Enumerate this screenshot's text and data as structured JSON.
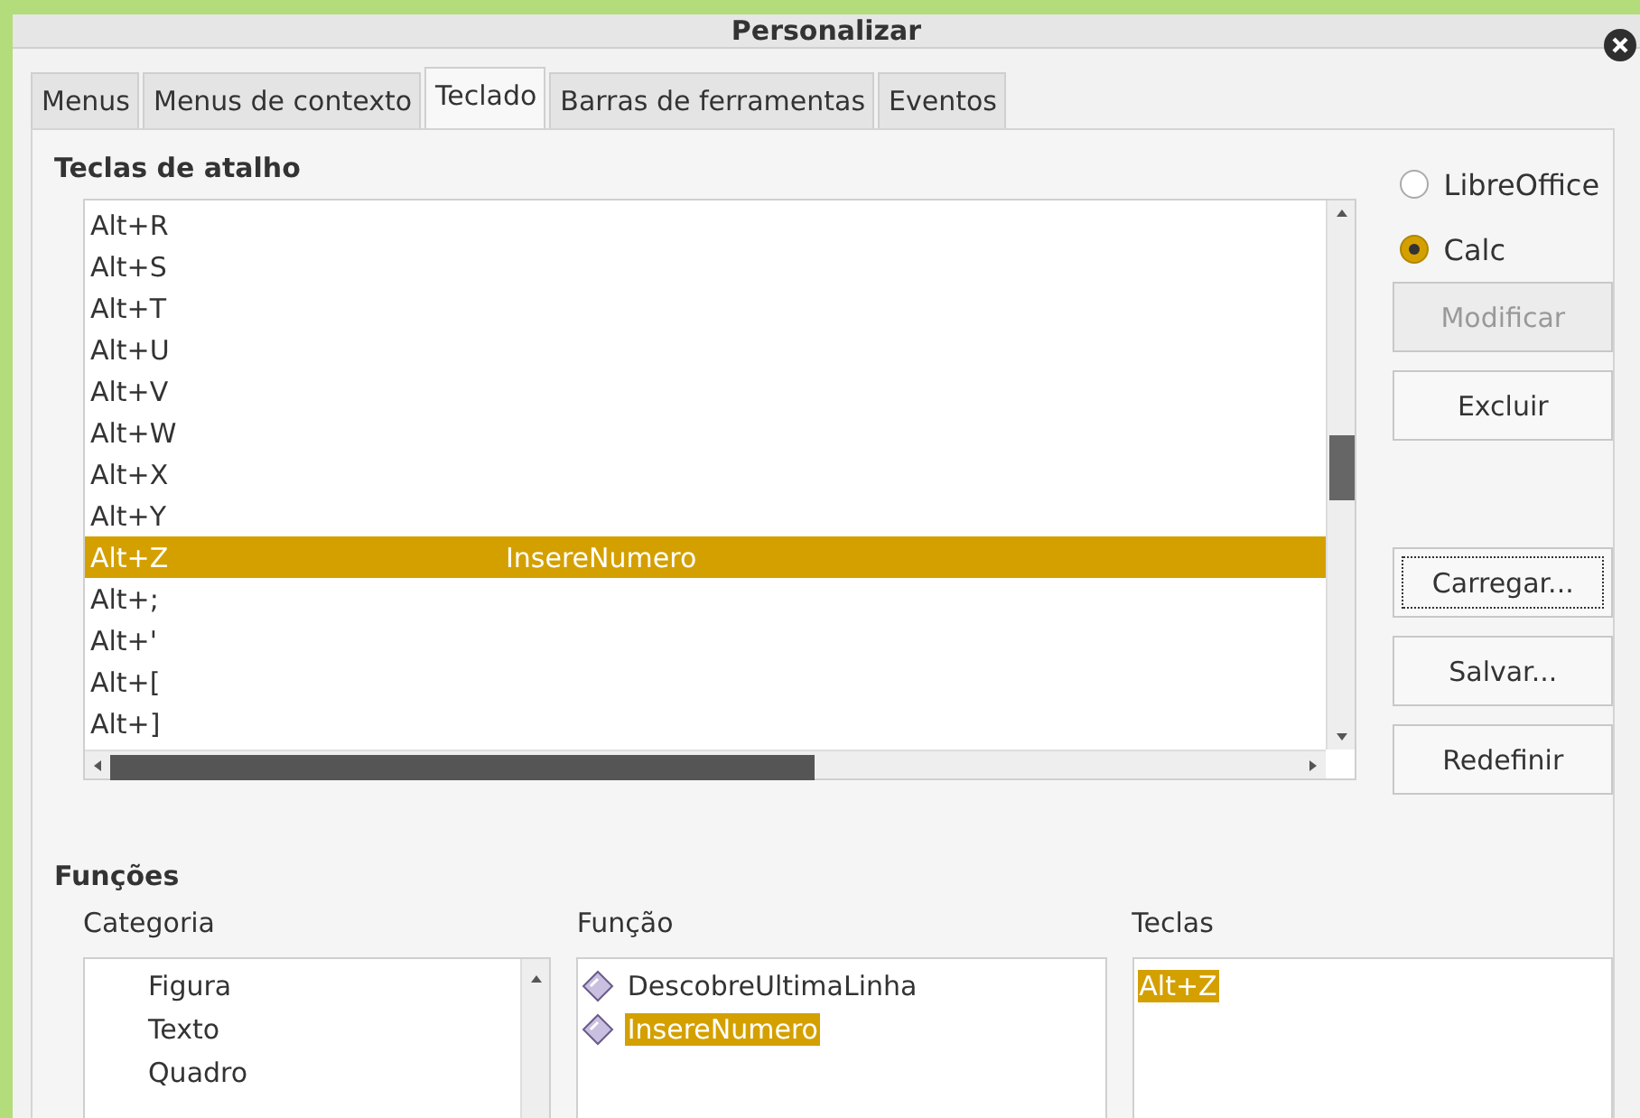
{
  "window": {
    "title": "Personalizar"
  },
  "tabs": [
    {
      "label": "Menus",
      "selected": false
    },
    {
      "label": "Menus de contexto",
      "selected": false
    },
    {
      "label": "Teclado",
      "selected": true
    },
    {
      "label": "Barras de ferramentas",
      "selected": false
    },
    {
      "label": "Eventos",
      "selected": false
    }
  ],
  "shortcuts": {
    "title": "Teclas de atalho",
    "rows": [
      {
        "key": "Alt+R",
        "function": "",
        "selected": false
      },
      {
        "key": "Alt+S",
        "function": "",
        "selected": false
      },
      {
        "key": "Alt+T",
        "function": "",
        "selected": false
      },
      {
        "key": "Alt+U",
        "function": "",
        "selected": false
      },
      {
        "key": "Alt+V",
        "function": "",
        "selected": false
      },
      {
        "key": "Alt+W",
        "function": "",
        "selected": false
      },
      {
        "key": "Alt+X",
        "function": "",
        "selected": false
      },
      {
        "key": "Alt+Y",
        "function": "",
        "selected": false
      },
      {
        "key": "Alt+Z",
        "function": "InsereNumero",
        "selected": true
      },
      {
        "key": "Alt+;",
        "function": "",
        "selected": false
      },
      {
        "key": "Alt+'",
        "function": "",
        "selected": false
      },
      {
        "key": "Alt+[",
        "function": "",
        "selected": false
      },
      {
        "key": "Alt+]",
        "function": "",
        "selected": false
      }
    ]
  },
  "scope": [
    {
      "label": "LibreOffice",
      "selected": false
    },
    {
      "label": "Calc",
      "selected": true
    }
  ],
  "buttons": [
    {
      "label": "Modificar",
      "disabled": true,
      "focused": false
    },
    {
      "label": "Excluir",
      "disabled": false,
      "focused": false
    },
    {
      "label": "Carregar...",
      "disabled": false,
      "focused": true
    },
    {
      "label": "Salvar...",
      "disabled": false,
      "focused": false
    },
    {
      "label": "Redefinir",
      "disabled": false,
      "focused": false
    }
  ],
  "functions": {
    "title": "Funções",
    "category": {
      "label": "Categoria",
      "items": [
        {
          "label": "Figura",
          "selected": false
        },
        {
          "label": "Texto",
          "selected": false
        },
        {
          "label": "Quadro",
          "selected": false
        }
      ]
    },
    "function": {
      "label": "Função",
      "items": [
        {
          "label": "DescobreUltimaLinha",
          "selected": false
        },
        {
          "label": "InsereNumero",
          "selected": true
        }
      ]
    },
    "keys": {
      "label": "Teclas",
      "items": [
        {
          "label": "Alt+Z",
          "selected": true
        }
      ]
    }
  }
}
